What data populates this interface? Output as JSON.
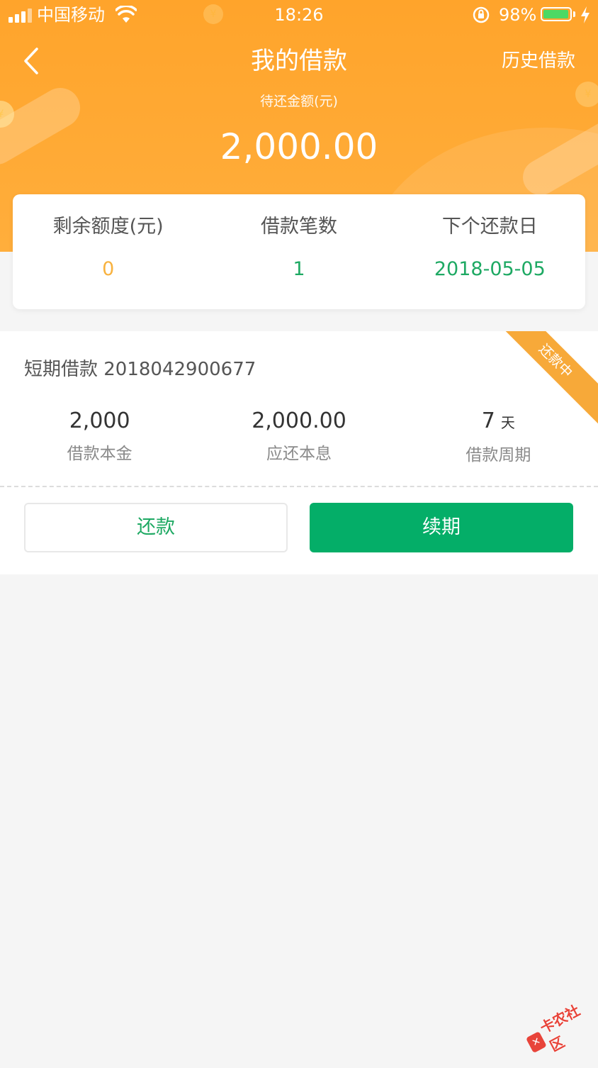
{
  "status_bar": {
    "carrier": "中国移动",
    "time": "18:26",
    "battery": "98%"
  },
  "nav": {
    "title": "我的借款",
    "history": "历史借款"
  },
  "due": {
    "label": "待还金额(元)",
    "amount": "2,000.00"
  },
  "summary": [
    {
      "label": "剩余额度(元)",
      "value": "0"
    },
    {
      "label": "借款笔数",
      "value": "1"
    },
    {
      "label": "下个还款日",
      "value": "2018-05-05"
    }
  ],
  "loan": {
    "title": "短期借款 2018042900677",
    "status": "还款中",
    "stats": [
      {
        "value": "2,000",
        "unit": "",
        "label": "借款本金"
      },
      {
        "value": "2,000.00",
        "unit": "",
        "label": "应还本息"
      },
      {
        "value": "7",
        "unit": "天",
        "label": "借款周期"
      }
    ],
    "repay_label": "还款",
    "renew_label": "续期"
  },
  "watermark": {
    "text": "卡农社区"
  },
  "colors": {
    "header_orange": "#ffa42b",
    "accent_green": "#04ae68",
    "value_orange": "#f8b23f",
    "ribbon_orange": "#f7a939"
  }
}
